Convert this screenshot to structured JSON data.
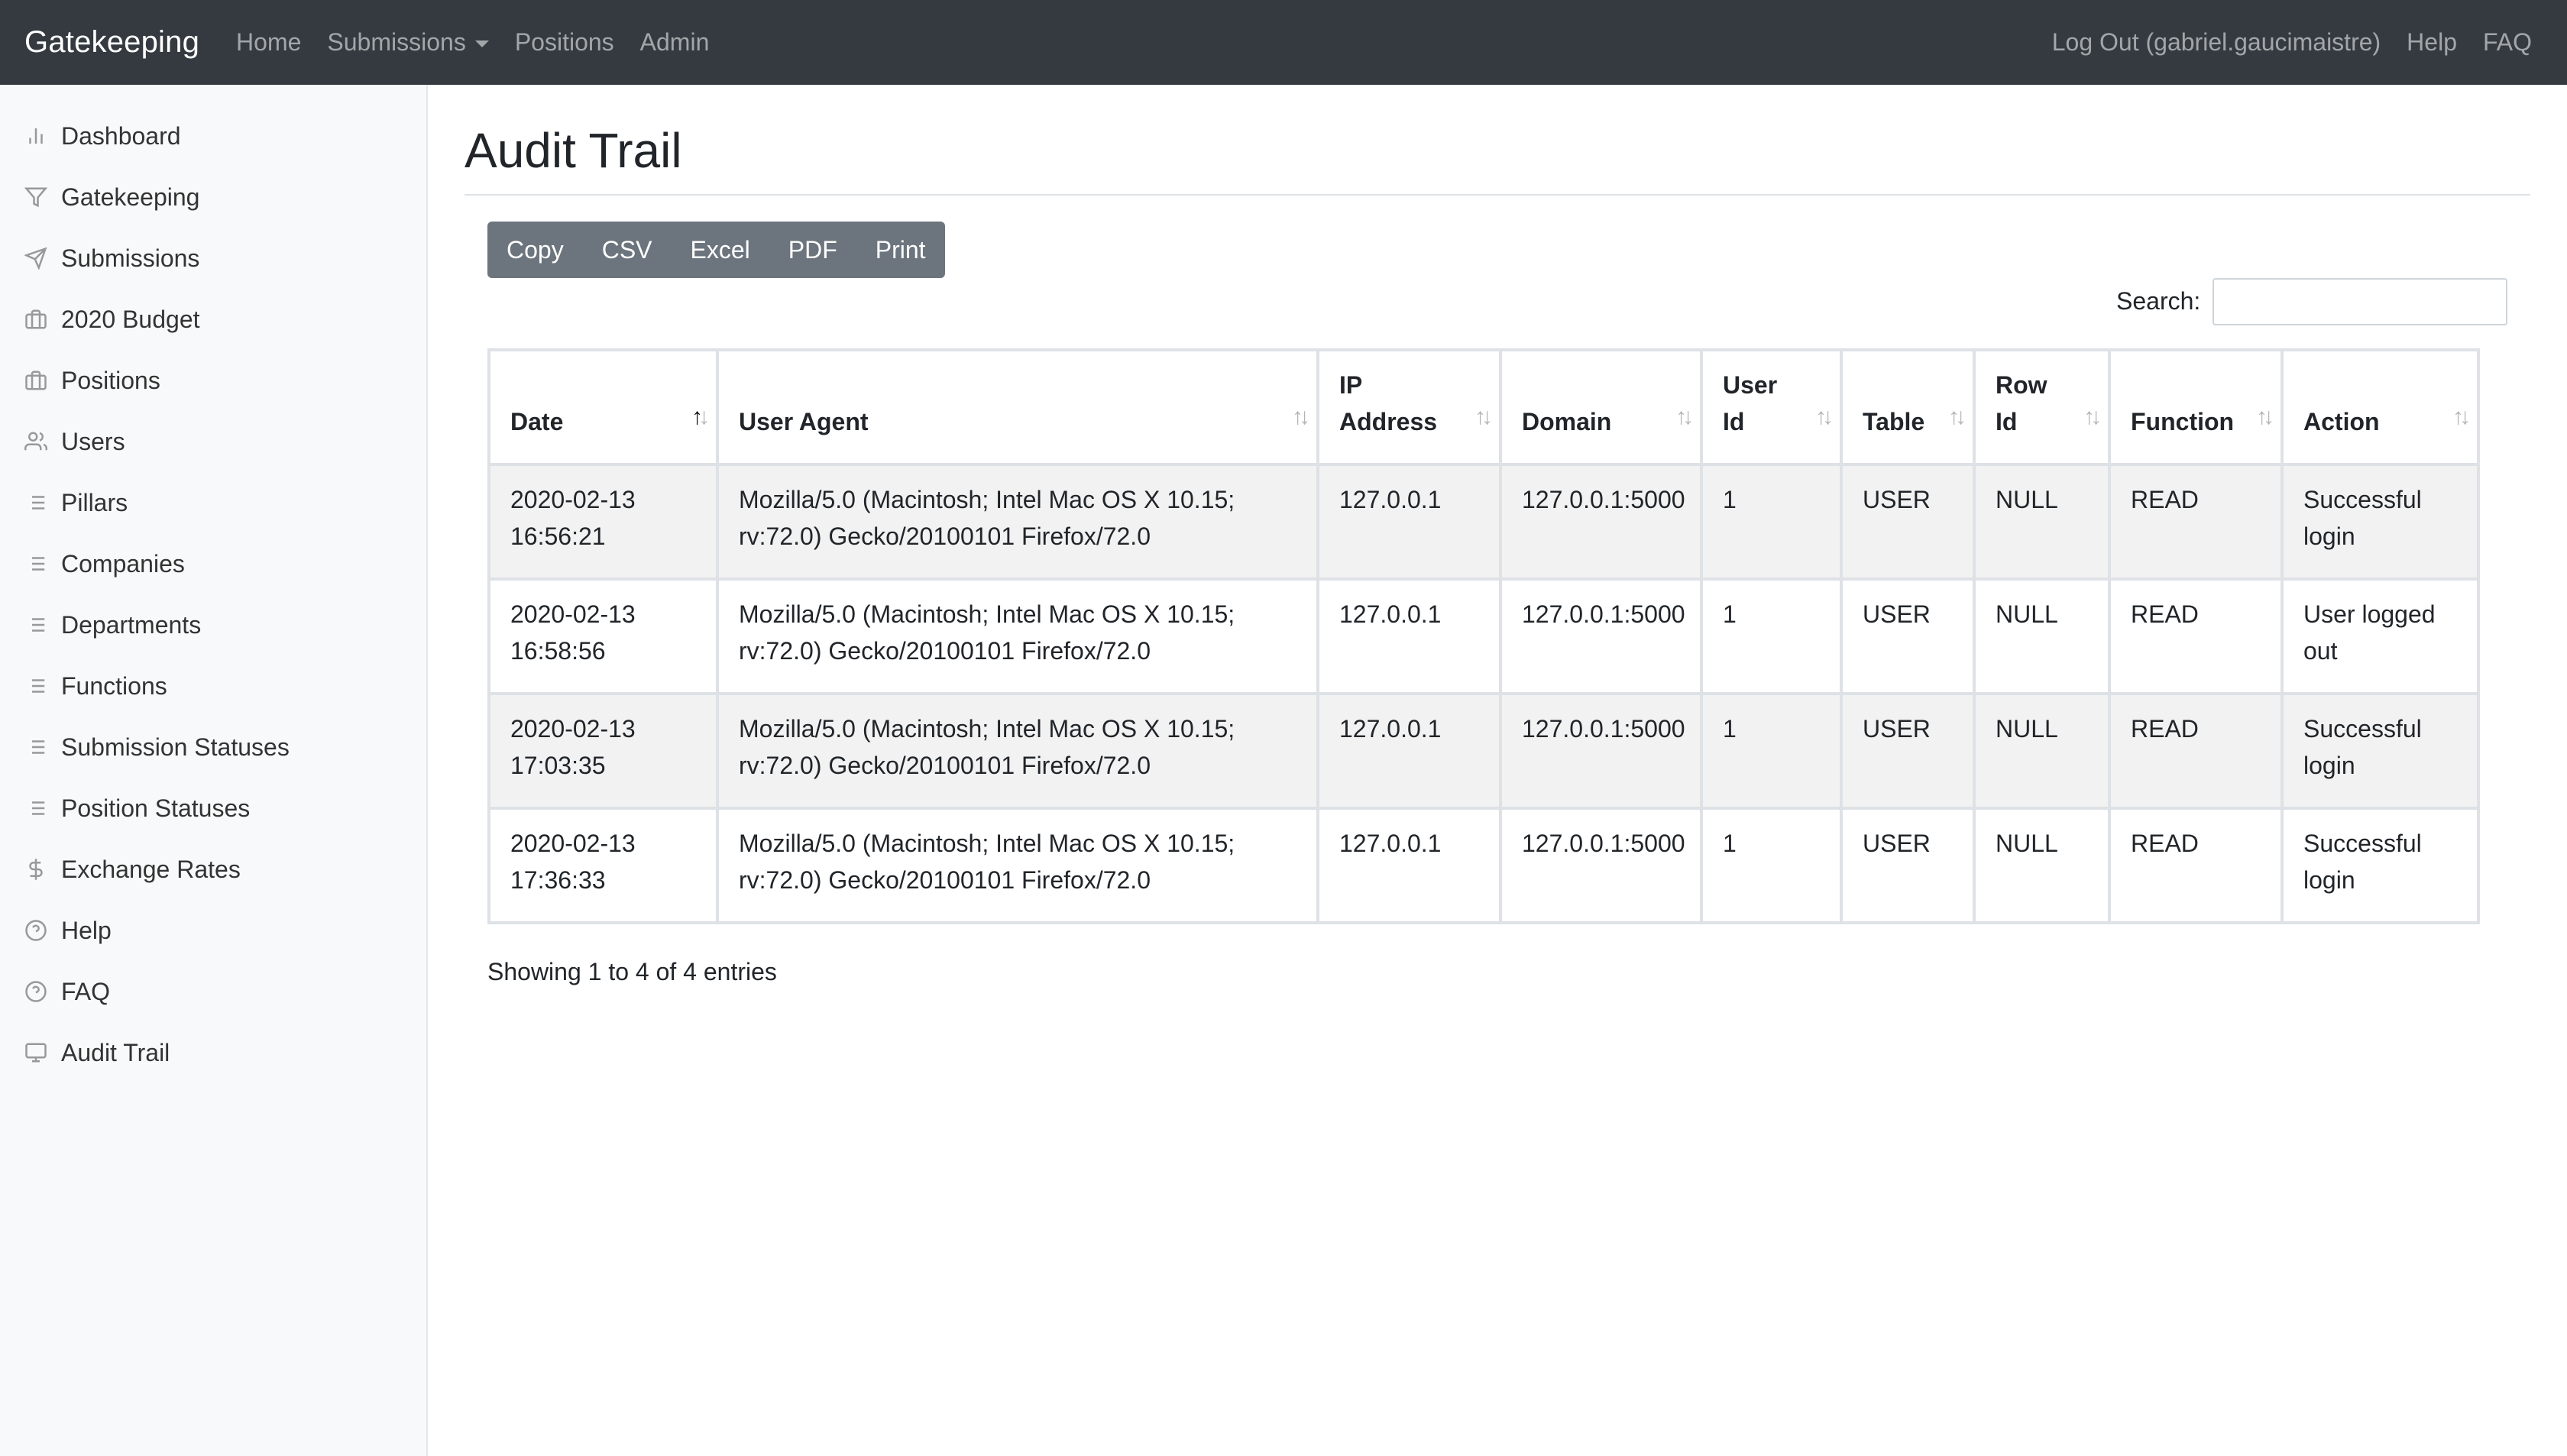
{
  "navbar": {
    "brand": "Gatekeeping",
    "links": [
      "Home",
      "Submissions",
      "Positions",
      "Admin"
    ],
    "right_links": [
      "Log Out (gabriel.gaucimaistre)",
      "Help",
      "FAQ"
    ]
  },
  "sidebar": {
    "items": [
      {
        "label": "Dashboard",
        "icon": "bar-chart-icon"
      },
      {
        "label": "Gatekeeping",
        "icon": "filter-icon"
      },
      {
        "label": "Submissions",
        "icon": "send-icon"
      },
      {
        "label": "2020 Budget",
        "icon": "briefcase-icon"
      },
      {
        "label": "Positions",
        "icon": "briefcase-icon"
      },
      {
        "label": "Users",
        "icon": "users-icon"
      },
      {
        "label": "Pillars",
        "icon": "list-icon"
      },
      {
        "label": "Companies",
        "icon": "list-icon"
      },
      {
        "label": "Departments",
        "icon": "list-icon"
      },
      {
        "label": "Functions",
        "icon": "list-icon"
      },
      {
        "label": "Submission Statuses",
        "icon": "list-icon"
      },
      {
        "label": "Position Statuses",
        "icon": "list-icon"
      },
      {
        "label": "Exchange Rates",
        "icon": "dollar-icon"
      },
      {
        "label": "Help",
        "icon": "help-circle-icon"
      },
      {
        "label": "FAQ",
        "icon": "help-circle-icon"
      },
      {
        "label": "Audit Trail",
        "icon": "monitor-icon"
      }
    ]
  },
  "main": {
    "title": "Audit Trail",
    "buttons": [
      "Copy",
      "CSV",
      "Excel",
      "PDF",
      "Print"
    ],
    "search": {
      "label": "Search:",
      "value": "",
      "placeholder": ""
    },
    "table": {
      "headers": [
        [
          "Date"
        ],
        [
          "User Agent"
        ],
        [
          "IP",
          "Address"
        ],
        [
          "Domain"
        ],
        [
          "User",
          "Id"
        ],
        [
          "Table"
        ],
        [
          "Row",
          "Id"
        ],
        [
          "Function"
        ],
        [
          "Action"
        ]
      ],
      "rows": [
        {
          "date": [
            "2020-02-13",
            "16:56:21"
          ],
          "user_agent": [
            "Mozilla/5.0 (Macintosh; Intel Mac OS X 10.15;",
            "rv:72.0) Gecko/20100101 Firefox/72.0"
          ],
          "ip": "127.0.0.1",
          "domain": "127.0.0.1:5000",
          "user_id": "1",
          "table": "USER",
          "row_id": "NULL",
          "function": "READ",
          "action": [
            "Successful",
            "login"
          ]
        },
        {
          "date": [
            "2020-02-13",
            "16:58:56"
          ],
          "user_agent": [
            "Mozilla/5.0 (Macintosh; Intel Mac OS X 10.15;",
            "rv:72.0) Gecko/20100101 Firefox/72.0"
          ],
          "ip": "127.0.0.1",
          "domain": "127.0.0.1:5000",
          "user_id": "1",
          "table": "USER",
          "row_id": "NULL",
          "function": "READ",
          "action": [
            "User logged",
            "out"
          ]
        },
        {
          "date": [
            "2020-02-13",
            "17:03:35"
          ],
          "user_agent": [
            "Mozilla/5.0 (Macintosh; Intel Mac OS X 10.15;",
            "rv:72.0) Gecko/20100101 Firefox/72.0"
          ],
          "ip": "127.0.0.1",
          "domain": "127.0.0.1:5000",
          "user_id": "1",
          "table": "USER",
          "row_id": "NULL",
          "function": "READ",
          "action": [
            "Successful",
            "login"
          ]
        },
        {
          "date": [
            "2020-02-13",
            "17:36:33"
          ],
          "user_agent": [
            "Mozilla/5.0 (Macintosh; Intel Mac OS X 10.15;",
            "rv:72.0) Gecko/20100101 Firefox/72.0"
          ],
          "ip": "127.0.0.1",
          "domain": "127.0.0.1:5000",
          "user_id": "1",
          "table": "USER",
          "row_id": "NULL",
          "function": "READ",
          "action": [
            "Successful",
            "login"
          ]
        }
      ]
    },
    "info": "Showing 1 to 4 of 4 entries"
  },
  "colors": {
    "navbar_bg": "#343a40",
    "sidebar_bg": "#f8f9fa",
    "button_bg": "#6c757d",
    "stripe_bg": "#f2f2f2"
  }
}
